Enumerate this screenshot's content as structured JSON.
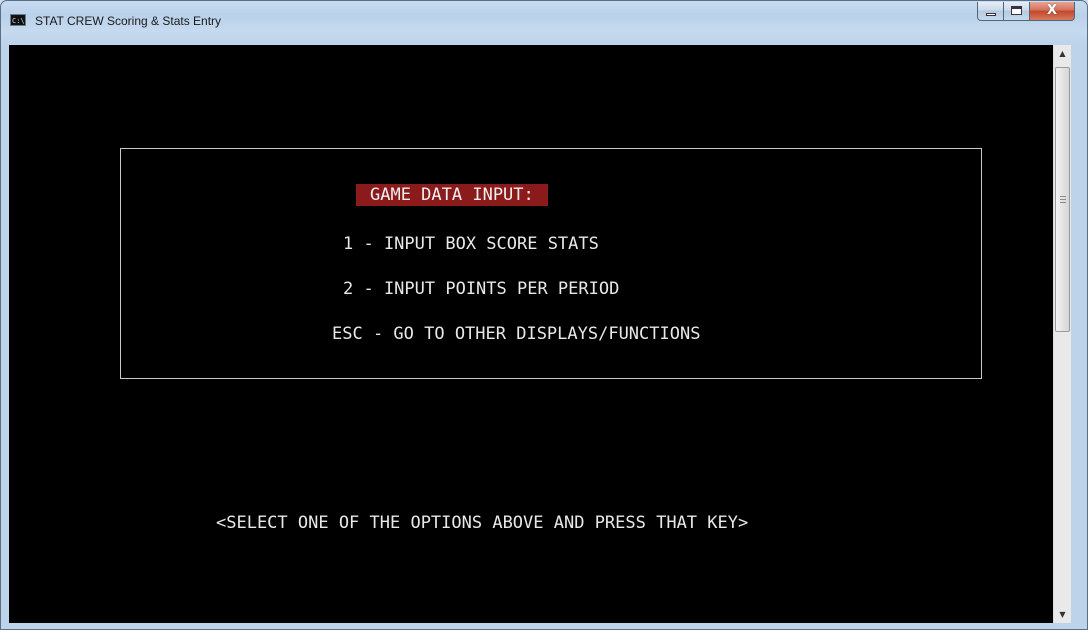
{
  "window": {
    "title": "STAT CREW Scoring & Stats Entry",
    "icon_text": "C:\\",
    "caption": {
      "minimize": "minimize",
      "maximize": "maximize",
      "close": "X"
    }
  },
  "menu": {
    "heading": "GAME DATA INPUT:",
    "options": [
      "1 - INPUT BOX SCORE STATS",
      "2 - INPUT POINTS PER PERIOD",
      "ESC - GO TO OTHER DISPLAYS/FUNCTIONS"
    ]
  },
  "prompt": "<SELECT ONE OF THE OPTIONS ABOVE AND PRESS THAT KEY>",
  "scrollbar": {
    "up_arrow": "▲",
    "down_arrow": "▼"
  },
  "colors": {
    "console_background": "#000000",
    "console_text": "#e8e8e8",
    "heading_highlight": "#8b1a1a",
    "title_bar": "#c4d8ee"
  }
}
